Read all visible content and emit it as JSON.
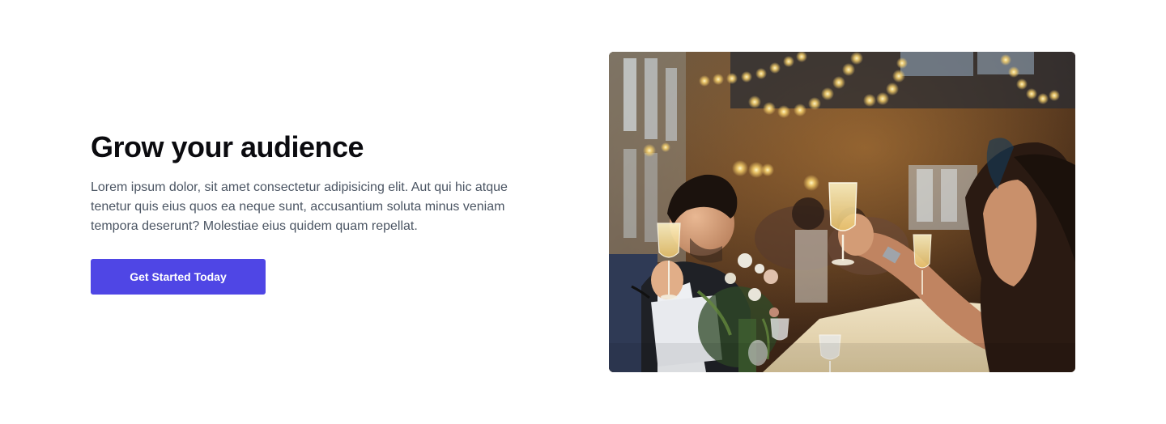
{
  "hero": {
    "headline": "Grow your audience",
    "body": "Lorem ipsum dolor, sit amet consectetur adipisicing elit. Aut qui hic atque tenetur quis eius quos ea neque sunt, accusantium soluta minus veniam tempora deserunt? Molestiae eius quidem quam repellat.",
    "cta_label": "Get Started Today"
  },
  "colors": {
    "accent": "#4f46e5",
    "headline": "#0b0b0f",
    "body_text": "#4b5563",
    "background": "#ffffff"
  }
}
